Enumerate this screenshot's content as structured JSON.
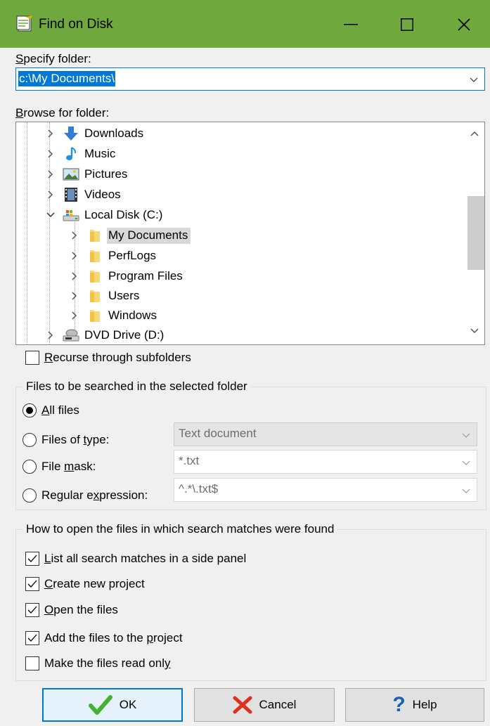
{
  "window": {
    "title": "Find on Disk",
    "titlebar_color": "#6fa83c"
  },
  "folder": {
    "label_accel": "S",
    "label_rest": "pecify folder:",
    "value": "c:\\My Documents\\"
  },
  "browse": {
    "label_accel": "B",
    "label_rest": "rowse for folder:",
    "items": [
      {
        "label": "Downloads",
        "icon": "download-icon",
        "state": "collapsed"
      },
      {
        "label": "Music",
        "icon": "music-note-icon",
        "state": "collapsed"
      },
      {
        "label": "Pictures",
        "icon": "pictures-icon",
        "state": "collapsed"
      },
      {
        "label": "Videos",
        "icon": "film-icon",
        "state": "collapsed"
      },
      {
        "label": "Local Disk (C:)",
        "icon": "local-disk-icon",
        "state": "expanded"
      },
      {
        "label": "My Documents",
        "icon": "folder-icon",
        "state": "collapsed",
        "selected": true
      },
      {
        "label": "PerfLogs",
        "icon": "folder-icon",
        "state": "collapsed"
      },
      {
        "label": "Program Files",
        "icon": "folder-icon",
        "state": "collapsed"
      },
      {
        "label": "Users",
        "icon": "folder-icon",
        "state": "collapsed"
      },
      {
        "label": "Windows",
        "icon": "folder-icon",
        "state": "collapsed"
      },
      {
        "label": "DVD Drive (D:)",
        "icon": "dvd-drive-icon",
        "state": "collapsed"
      }
    ]
  },
  "recurse": {
    "accel": "R",
    "rest": "ecurse through subfolders",
    "checked": false
  },
  "files_group": {
    "title": "Files to be searched in the selected folder",
    "all": {
      "accel": "A",
      "rest": "ll files",
      "checked": true
    },
    "type": {
      "pre": "Files of ",
      "accel": "t",
      "post": "ype:",
      "checked": false,
      "value": "Text document"
    },
    "mask": {
      "pre": "File ",
      "accel": "m",
      "post": "ask:",
      "checked": false,
      "value": "*.txt"
    },
    "regex": {
      "pre": "Regular e",
      "accel": "x",
      "post": "pression:",
      "checked": false,
      "value": "^.*\\.txt$"
    }
  },
  "open_group": {
    "title": "How to open the files in which search matches were found",
    "options": [
      {
        "pre": "",
        "accel": "L",
        "post": "ist all search matches in a side panel",
        "checked": true
      },
      {
        "pre": "",
        "accel": "C",
        "post": "reate new project",
        "checked": true
      },
      {
        "pre": "",
        "accel": "O",
        "post": "pen the files",
        "checked": true
      },
      {
        "pre": "Add the files to the ",
        "accel": "p",
        "post": "roject",
        "checked": true
      },
      {
        "pre": "Make the files read onl",
        "accel": "y",
        "post": "",
        "checked": false
      }
    ]
  },
  "buttons": {
    "ok": "OK",
    "cancel": "Cancel",
    "help": "Help"
  }
}
